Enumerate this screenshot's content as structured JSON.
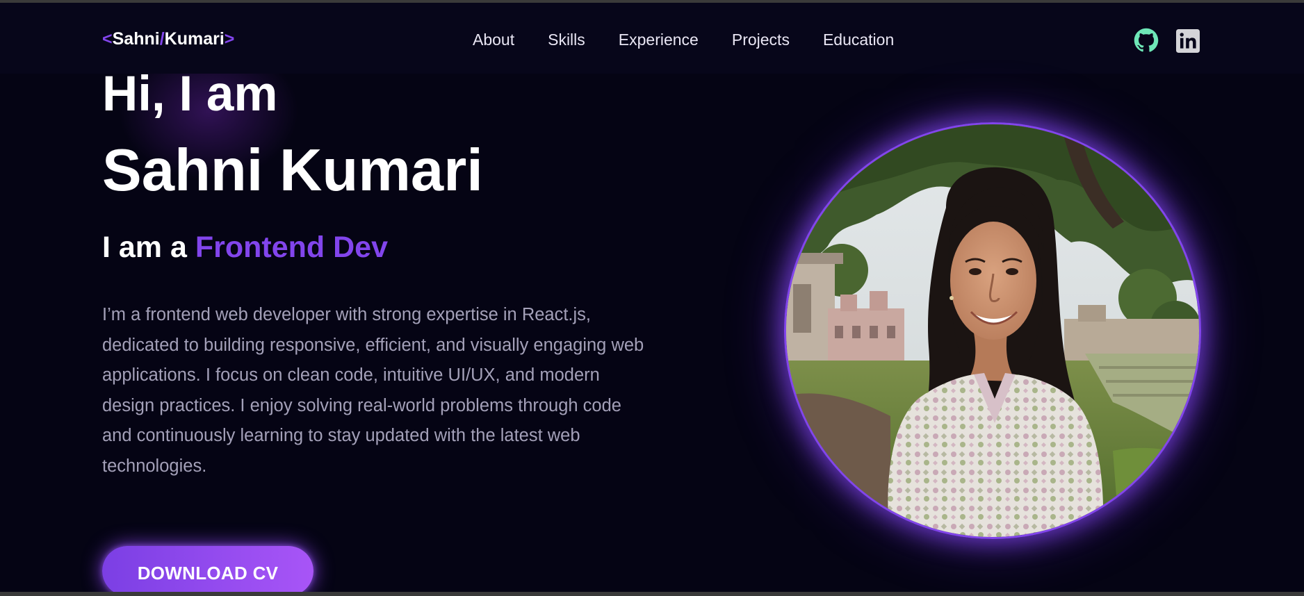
{
  "logo": {
    "open": "<",
    "first": "Sahni",
    "slash": "/",
    "last": "Kumari",
    "close": ">"
  },
  "nav": {
    "items": [
      "About",
      "Skills",
      "Experience",
      "Projects",
      "Education"
    ]
  },
  "social": {
    "github_icon": "github-icon",
    "linkedin_icon": "linkedin-icon",
    "github_color": "#6ee7b7",
    "linkedin_color": "#d4d4d8"
  },
  "hero": {
    "greeting": "Hi, I am",
    "name": "Sahni Kumari",
    "role_prefix": "I am a ",
    "role": "Frontend Dev",
    "description": "I’m a frontend web developer with strong expertise in React.js, dedicated to building responsive, efficient, and visually engaging web applications. I focus on clean code, intuitive UI/UX, and modern design practices. I enjoy solving real-world problems through code and continuously learning to stay updated with the latest web technologies.",
    "cta_label": "DOWNLOAD CV"
  },
  "profile": {
    "image_name": "profile-photo"
  },
  "colors": {
    "background": "#050414",
    "accent": "#8245ec",
    "text": "#ffffff",
    "muted_text": "#a3a0b8"
  }
}
